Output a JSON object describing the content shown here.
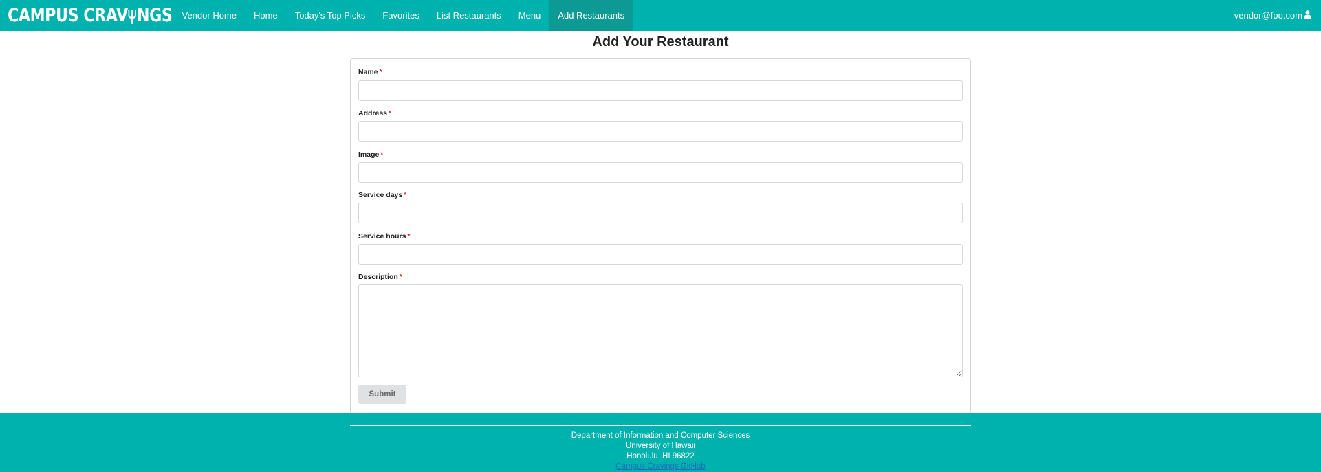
{
  "navbar": {
    "brand": "CAMPUS CRAV",
    "brand_suffix": "NGS",
    "items": [
      {
        "label": "Vendor Home"
      },
      {
        "label": "Home"
      },
      {
        "label": "Today's Top Picks"
      },
      {
        "label": "Favorites"
      },
      {
        "label": "List Restaurants"
      },
      {
        "label": "Menu"
      },
      {
        "label": "Add Restaurants"
      }
    ],
    "active_item": "Add Restaurants",
    "user": "vendor@foo.com",
    "colors": {
      "background": "#00b2ad",
      "active": "#0d9a95"
    }
  },
  "page": {
    "title": "Add Your Restaurant"
  },
  "form": {
    "fields": [
      {
        "label": "Name",
        "required_marker": "*",
        "value": ""
      },
      {
        "label": "Address",
        "required_marker": "*",
        "value": ""
      },
      {
        "label": "Image",
        "required_marker": "*",
        "value": ""
      },
      {
        "label": "Service days",
        "required_marker": "*",
        "value": ""
      },
      {
        "label": "Service hours",
        "required_marker": "*",
        "value": ""
      },
      {
        "label": "Description",
        "required_marker": "*",
        "value": ""
      }
    ],
    "submit_label": "Submit"
  },
  "footer": {
    "line1": "Department of Information and Computer Sciences",
    "line2": "University of Hawaii",
    "line3": "Honolulu, HI 96822",
    "link": "Campus Cravings GitHub"
  },
  "icons": {
    "user": "user-icon",
    "fork": "fork-icon"
  }
}
